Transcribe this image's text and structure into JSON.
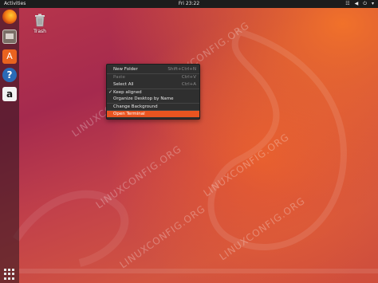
{
  "topbar": {
    "activities": "Activities",
    "clock": "Fri 23:22",
    "tray_icons": [
      "network-icon",
      "volume-icon",
      "power-icon",
      "dropdown-icon"
    ]
  },
  "dock": {
    "items": [
      {
        "name": "firefox-icon"
      },
      {
        "name": "files-icon"
      },
      {
        "name": "software-icon",
        "glyph": "A"
      },
      {
        "name": "help-icon",
        "glyph": "?"
      },
      {
        "name": "amazon-icon",
        "glyph": "a"
      }
    ],
    "show_apps": "app-grid-icon"
  },
  "desktop": {
    "trash_label": "Trash"
  },
  "context_menu": {
    "items": [
      {
        "label": "New Folder",
        "shortcut": "Shift+Ctrl+N",
        "enabled": true
      },
      {
        "label": "Paste",
        "shortcut": "Ctrl+V",
        "enabled": false
      },
      {
        "label": "Select All",
        "shortcut": "Ctrl+A",
        "enabled": true
      },
      {
        "label": "Keep aligned",
        "checked": true,
        "enabled": true
      },
      {
        "label": "Organize Desktop by Name",
        "enabled": true
      },
      {
        "label": "Change Background",
        "enabled": true
      },
      {
        "label": "Open Terminal",
        "enabled": true,
        "highlighted": true
      }
    ]
  },
  "watermark": "LINUXCONFIG.ORG",
  "colors": {
    "accent": "#e95420",
    "topbar": "#1c1c1c",
    "menu_bg": "#2f2f2f"
  }
}
